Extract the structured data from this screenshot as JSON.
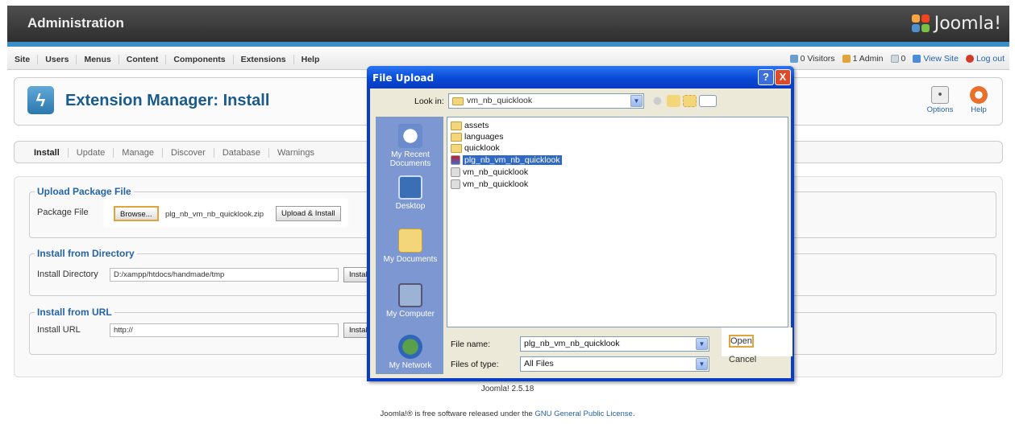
{
  "header": {
    "title": "Administration",
    "logo_text": "Joomla!"
  },
  "menubar": {
    "items": [
      "Site",
      "Users",
      "Menus",
      "Content",
      "Components",
      "Extensions",
      "Help"
    ],
    "status": {
      "visitors": "0 Visitors",
      "admins": "1 Admin",
      "messages": "0",
      "view_site": "View Site",
      "logout": "Log out"
    }
  },
  "toolbar": {
    "page_title": "Extension Manager: Install",
    "options_label": "Options",
    "help_label": "Help"
  },
  "submenu": {
    "tabs": [
      "Install",
      "Update",
      "Manage",
      "Discover",
      "Database",
      "Warnings"
    ],
    "active": "Install"
  },
  "upload_package": {
    "legend": "Upload Package File",
    "label": "Package File",
    "browse_label": "Browse...",
    "file_value": "plg_nb_vm_nb_quicklook.zip",
    "submit_label": "Upload & Install"
  },
  "install_directory": {
    "legend": "Install from Directory",
    "label": "Install Directory",
    "value": "D:/xampp/htdocs/handmade/tmp",
    "button_label": "Instal"
  },
  "install_url": {
    "legend": "Install from URL",
    "label": "Install URL",
    "value": "http://",
    "button_label": "Instal"
  },
  "footer": {
    "version": "Joomla! 2.5.18",
    "license_prefix": "Joomla!® is free software released under the ",
    "license_link": "GNU General Public License",
    "license_suffix": "."
  },
  "dialog": {
    "title": "File Upload",
    "help_btn": "?",
    "close_btn": "X",
    "look_in_label": "Look in:",
    "look_in_value": "vm_nb_quicklook",
    "places": [
      "My Recent Documents",
      "Desktop",
      "My Documents",
      "My Computer",
      "My Network"
    ],
    "files": [
      {
        "name": "assets",
        "type": "folder"
      },
      {
        "name": "languages",
        "type": "folder"
      },
      {
        "name": "quicklook",
        "type": "folder"
      },
      {
        "name": "plg_nb_vm_nb_quicklook",
        "type": "archive",
        "selected": true
      },
      {
        "name": "vm_nb_quicklook",
        "type": "file"
      },
      {
        "name": "vm_nb_quicklook",
        "type": "file"
      }
    ],
    "file_name_label": "File name:",
    "file_name_value": "plg_nb_vm_nb_quicklook",
    "file_type_label": "Files of type:",
    "file_type_value": "All Files",
    "open_label": "Open",
    "cancel_label": "Cancel"
  },
  "colors": {
    "accent": "#2564a8",
    "dialog_title": "#0547d3",
    "selection": "#316ac5"
  }
}
